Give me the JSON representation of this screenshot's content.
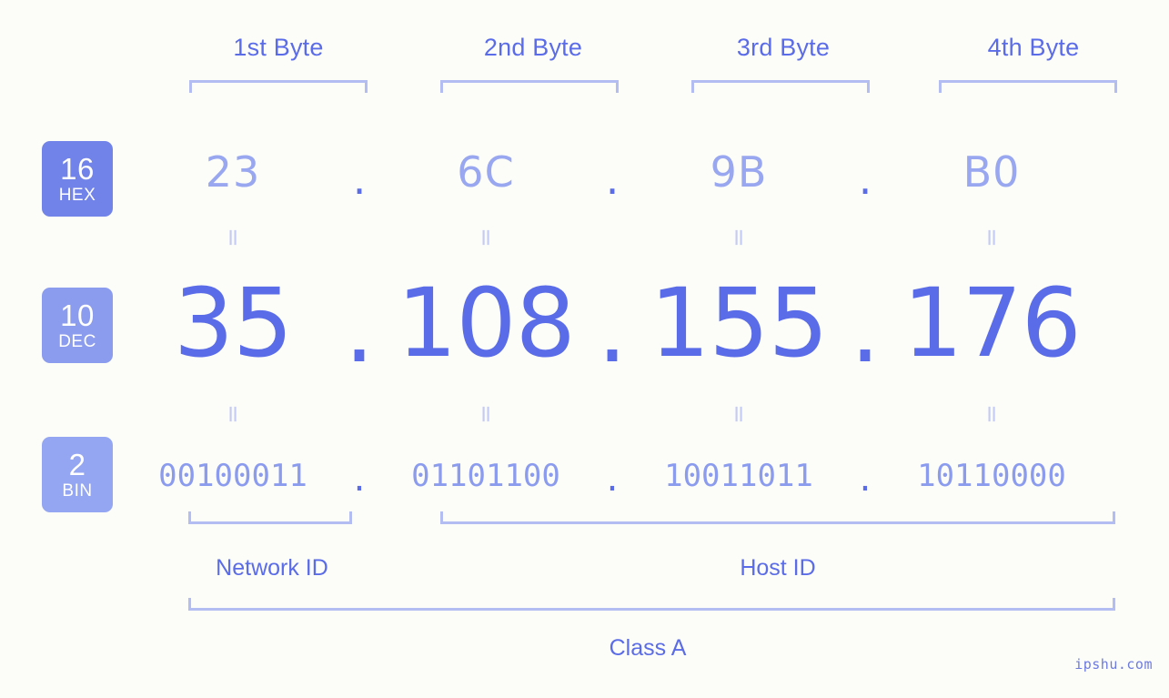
{
  "page": {
    "background": "#fcfdf8",
    "accent": "#5b6ce8",
    "accent_light": "#98a7f0",
    "bracket_color": "#b3bdf2",
    "watermark": "ipshu.com"
  },
  "byte_headers": [
    {
      "label": "1st Byte"
    },
    {
      "label": "2nd Byte"
    },
    {
      "label": "3rd Byte"
    },
    {
      "label": "4th Byte"
    }
  ],
  "bases": [
    {
      "number": "16",
      "name": "HEX",
      "color": "#7183e8"
    },
    {
      "number": "10",
      "name": "DEC",
      "color": "#8b9bee"
    },
    {
      "number": "2",
      "name": "BIN",
      "color": "#94a6f2"
    }
  ],
  "separator": ".",
  "equals_mark": "=",
  "rows": {
    "hex": {
      "base_number": "16",
      "base_name": "HEX",
      "values": [
        "23",
        "6C",
        "9B",
        "B0"
      ]
    },
    "dec": {
      "base_number": "10",
      "base_name": "DEC",
      "values": [
        "35",
        "108",
        "155",
        "176"
      ]
    },
    "bin": {
      "base_number": "2",
      "base_name": "BIN",
      "values": [
        "00100011",
        "01101100",
        "10011011",
        "10110000"
      ]
    }
  },
  "ip_address": {
    "hex": "23.6C.9B.B0",
    "decimal": "35.108.155.176",
    "binary": "00100011.01101100.10011011.10110000"
  },
  "sections": {
    "network_id": "Network ID",
    "host_id": "Host ID",
    "class": "Class A"
  }
}
